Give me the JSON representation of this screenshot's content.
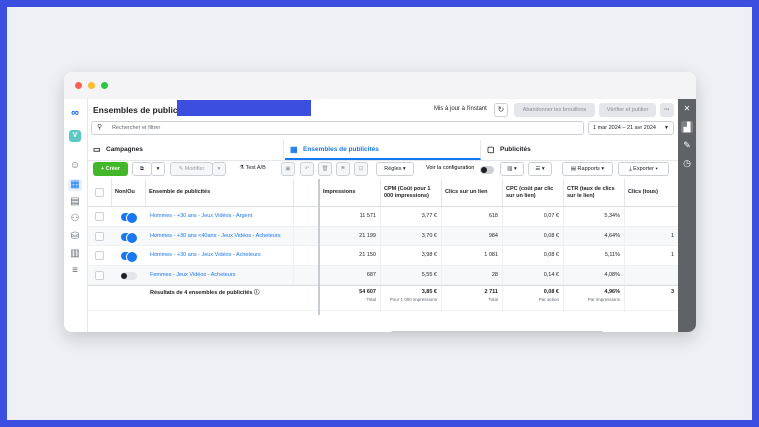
{
  "header": {
    "title": "Ensembles de publicités",
    "updated": "Mis à jour à l'instant",
    "discard_label": "Abandonner les brouillons",
    "review_label": "Vérifier et publier",
    "more": "···"
  },
  "nav": {
    "avatar_letter": "V"
  },
  "search": {
    "placeholder": "Rechercher et filtrer"
  },
  "date_range": "1 mar 2024 – 21 avr 2024",
  "tabs": [
    {
      "label": "Campagnes"
    },
    {
      "label": "Ensembles de publicités"
    },
    {
      "label": "Publicités"
    }
  ],
  "toolbar": {
    "create": "+ Créer",
    "modify": "Modifier",
    "ab_test": "Test A/B",
    "rules": "Règles",
    "view_config": "Voir la configuration",
    "reports": "Rapports",
    "export": "Exporter"
  },
  "table": {
    "headers": {
      "onoff": "Non/Ou",
      "name": "Ensemble de publicités",
      "impressions": "Impressions",
      "cpm": "CPM (Coût pour 1 000 impressions)",
      "clicks": "Clics sur un lien",
      "cpc": "CPC (coût par clic sur un lien)",
      "ctr": "CTR (taux de clics sur le lien)",
      "clics_tous": "Clics (tous)"
    },
    "rows": [
      {
        "name": "Hommes - +30 ans - Jeux Vidéos - Argent",
        "on": true,
        "impressions": "11 571",
        "cpm": "3,77 €",
        "clicks": "618",
        "cpc": "0,07 €",
        "ctr": "5,34%",
        "extra": ""
      },
      {
        "name": "Hommes - +30 ans <40ans - Jeux Vidéos - Acheteurs",
        "on": true,
        "impressions": "21 199",
        "cpm": "3,70 €",
        "clicks": "984",
        "cpc": "0,08 €",
        "ctr": "4,64%",
        "extra": "1"
      },
      {
        "name": "Hommes - +30 ans - Jeux Vidéos - Acheteurs",
        "on": true,
        "impressions": "21 150",
        "cpm": "3,98 €",
        "clicks": "1 081",
        "cpc": "0,08 €",
        "ctr": "5,11%",
        "extra": "1"
      },
      {
        "name": "Femmes - Jeux Vidéos - Acheteurs",
        "on": false,
        "impressions": "687",
        "cpm": "5,55 €",
        "clicks": "28",
        "cpc": "0,14 €",
        "ctr": "4,08%",
        "extra": ""
      }
    ],
    "summary": {
      "label": "Résultats de 4 ensembles de publicités",
      "impressions": "54 607",
      "impressions_sub": "Total",
      "cpm": "3,85 €",
      "cpm_sub": "Pour 1 000 impressions",
      "clicks": "2 711",
      "clicks_sub": "Total",
      "cpc": "0,08 €",
      "cpc_sub": "Par action",
      "ctr": "4,96%",
      "ctr_sub": "Par impressions",
      "extra": "3"
    }
  },
  "colors": {
    "frame": "#3b4ee0",
    "accent": "#1877f2",
    "create": "#42b72a"
  }
}
